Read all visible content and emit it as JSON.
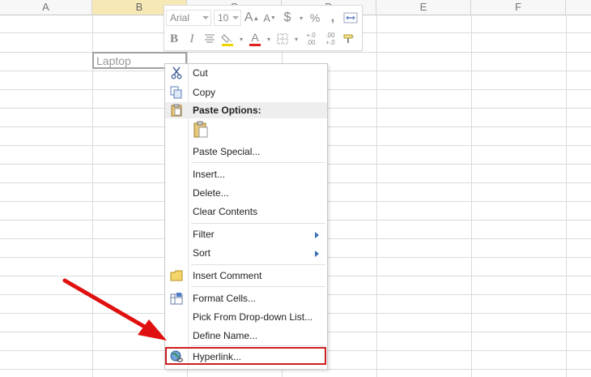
{
  "columns": [
    "A",
    "B",
    "C",
    "D",
    "E",
    "F"
  ],
  "selected_cell_value": "Laptop",
  "mini_toolbar": {
    "font_name": "Arial",
    "font_size": "10",
    "increase_font_glyph": "A",
    "decrease_font_glyph": "A",
    "currency_glyph": "$",
    "percent_glyph": "%",
    "comma_glyph": ",",
    "bold_glyph": "B",
    "italic_glyph": "I",
    "font_color_glyph": "A",
    "increase_decimal_glyph": "+.0 .00",
    "decrease_decimal_glyph": ".00 +.0",
    "accent_fill": "#f2d200",
    "accent_font": "#e02020"
  },
  "context_menu": {
    "cut": "Cut",
    "copy": "Copy",
    "paste_options": "Paste Options:",
    "paste_special": "Paste Special...",
    "insert": "Insert...",
    "delete": "Delete...",
    "clear_contents": "Clear Contents",
    "filter": "Filter",
    "sort": "Sort",
    "insert_comment": "Insert Comment",
    "format_cells": "Format Cells...",
    "pick_from_list": "Pick From Drop-down List...",
    "define_name": "Define Name...",
    "hyperlink": "Hyperlink..."
  },
  "colors": {
    "highlight_box": "#cc1f1f",
    "arrow": "#e01010",
    "selected_column": "#f6e9b5"
  }
}
